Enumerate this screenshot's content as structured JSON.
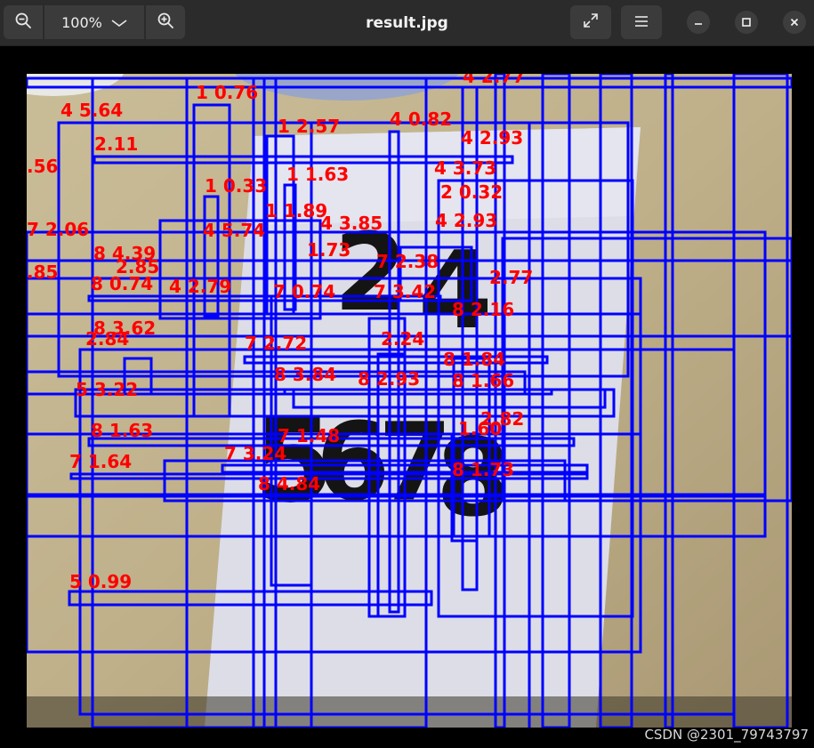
{
  "window": {
    "title": "result.jpg"
  },
  "toolbar": {
    "zoom_out_icon": "zoom-out-icon",
    "zoom_level": "100%",
    "zoom_menu_icon": "chevron-down-icon",
    "zoom_in_icon": "zoom-in-icon",
    "fullscreen_icon": "fullscreen-icon",
    "menu_icon": "hamburger-menu-icon"
  },
  "window_controls": {
    "minimize_icon": "minimize-icon",
    "maximize_icon": "maximize-icon",
    "close_icon": "close-icon"
  },
  "image": {
    "box_color": "#0000ff",
    "label_color": "#ff0000",
    "paper_digits": [
      "2",
      "4",
      "5",
      "6",
      "7",
      "8"
    ],
    "detections": [
      "4 5.64",
      "1 0.76",
      "1 2.57",
      "4 0.82",
      "4 2.77",
      "4 2.93",
      "2.11",
      "1 1.63",
      "4 3.73",
      ".56",
      "1 0.33",
      "2 0.32",
      "1 1.89",
      "7 2.06",
      "4 5.74",
      "4 2.93",
      "4 3.85",
      "8 4.39",
      "2.85",
      "1.73",
      "7 2.38",
      ".85",
      "8 0.74",
      "4 2.79",
      "2.77",
      "7 0.74",
      "7 3.42",
      "8 2.16",
      "8 3.62",
      "2.84",
      "7 2.72",
      "8 3.84",
      "2.24",
      "8 1.84",
      "8 1.66",
      "5 3.22",
      "8 2.93",
      "2.82",
      "8 1.63",
      "7 1.48",
      "1.60",
      "7 1.64",
      "7 3.24",
      "8 1.73",
      "8 4.84",
      "5 0.99"
    ]
  },
  "watermark": "CSDN @2301_79743797"
}
